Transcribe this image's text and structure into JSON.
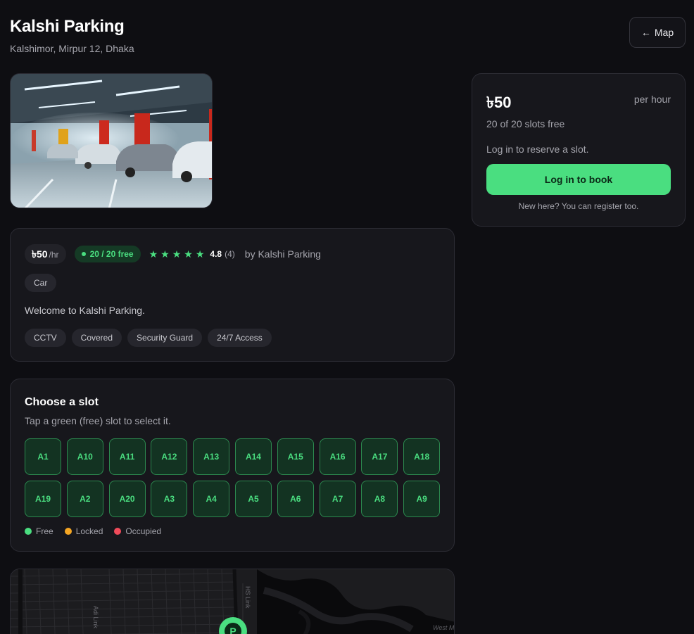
{
  "page": {
    "title": "Kalshi Parking",
    "address": "Kalshimor, Mirpur 12, Dhaka",
    "map_button": "Map",
    "back_arrow": "←"
  },
  "info": {
    "price": "৳50",
    "price_unit": "/hr",
    "free_badge": "20 / 20 free",
    "stars": [
      "★",
      "★",
      "★",
      "★",
      "★"
    ],
    "rating": "4.8",
    "review_count": "(4)",
    "owner": "by Kalshi Parking",
    "vehicle_type": "Car",
    "description": "Welcome to Kalshi Parking.",
    "amenities": [
      "CCTV",
      "Covered",
      "Security Guard",
      "24/7 Access"
    ]
  },
  "slots": {
    "title": "Choose a slot",
    "subtitle": "Tap a green (free) slot to select it.",
    "items": [
      "A1",
      "A10",
      "A11",
      "A12",
      "A13",
      "A14",
      "A15",
      "A16",
      "A17",
      "A18",
      "A19",
      "A2",
      "A20",
      "A3",
      "A4",
      "A5",
      "A6",
      "A7",
      "A8",
      "A9"
    ],
    "legend": [
      {
        "label": "Free",
        "color": "#4ade80"
      },
      {
        "label": "Locked",
        "color": "#f5a623"
      },
      {
        "label": "Occupied",
        "color": "#f04b5a"
      }
    ]
  },
  "booking": {
    "price": "৳50",
    "per": "per hour",
    "availability": "20 of 20 slots free",
    "note": "Log in to reserve a slot.",
    "button": "Log in to book",
    "register_note": "New here? You can register too."
  },
  "map": {
    "road_label_1": "HS Link",
    "road_label_2": "Adi Link",
    "corner_label": "West M",
    "marker_letter": "P"
  },
  "colors": {
    "accent": "#4ade80",
    "background": "#0e0e12",
    "card": "#17171c"
  }
}
